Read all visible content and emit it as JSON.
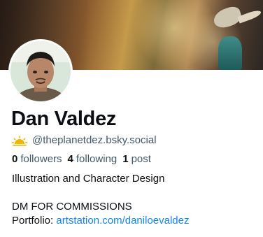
{
  "profile": {
    "display_name": "Dan Valdez",
    "handle": "@theplanetdez.bsky.social",
    "handle_icon": "sun-icon",
    "stats": {
      "followers_count": "0",
      "followers_label": "followers",
      "following_count": "4",
      "following_label": "following",
      "posts_count": "1",
      "posts_label": "post"
    },
    "bio": {
      "line1": "Illustration and Character Design",
      "line2": "DM FOR COMMISSIONS",
      "portfolio_label": "Portfolio: ",
      "portfolio_link": "artstation.com/daniloevaldez"
    }
  },
  "colors": {
    "text_primary": "#0b0f14",
    "text_secondary": "#42576c",
    "link": "#1083fe",
    "sun_icon": "#f5b400"
  }
}
